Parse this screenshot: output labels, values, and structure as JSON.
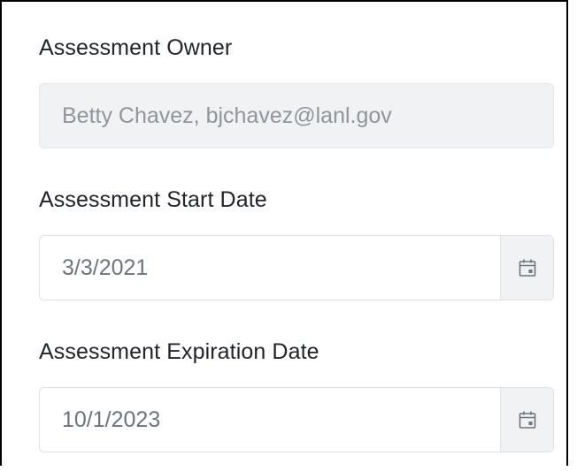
{
  "owner": {
    "label": "Assessment Owner",
    "value": "Betty Chavez, bjchavez@lanl.gov"
  },
  "start_date": {
    "label": "Assessment Start Date",
    "value": "3/3/2021",
    "icon": "calendar-icon"
  },
  "expiration_date": {
    "label": "Assessment Expiration Date",
    "value": "10/1/2023",
    "icon": "calendar-icon"
  },
  "colors": {
    "label_text": "#212529",
    "value_text": "#6c757d",
    "readonly_bg": "#f1f2f4",
    "border": "#dee2e6"
  }
}
